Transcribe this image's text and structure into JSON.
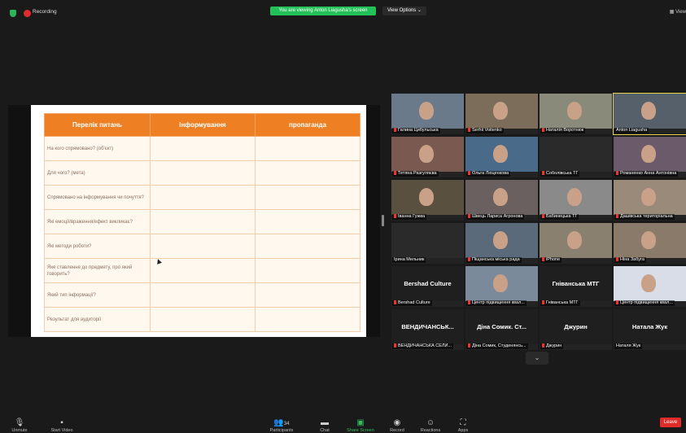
{
  "topbar": {
    "recording": "Recording",
    "viewing_banner": "You are viewing Anton Liagusha's screen",
    "view_options": "View Options ⌄",
    "view": "▦ View"
  },
  "slide": {
    "headers": [
      "Перелік питань",
      "Інформування",
      "пропаганда"
    ],
    "rows": [
      "На кого спрямовано? (об'єкт)",
      "Для чого? (мета)",
      "Спрямовано на інформування чи почуття?",
      "Які емоції/враження/ефект викликає?",
      "Які методи роботи?",
      "Яке ставлення до предмету, про який говорить?",
      "Який тип інформації?",
      "Результат для аудиторії"
    ]
  },
  "gallery": {
    "tiles": [
      {
        "name": "Галина Цибульська",
        "muted": true
      },
      {
        "name": "Serhii Voitenko",
        "muted": true
      },
      {
        "name": "Наталія Воротнюк",
        "muted": true
      },
      {
        "name": "Anton Liagusha",
        "muted": false
      },
      {
        "name": "Тетяна Разгуляєва",
        "muted": true
      },
      {
        "name": "Ольга Люценкова",
        "muted": true
      },
      {
        "name": "Соболівська ТГ",
        "muted": true
      },
      {
        "name": "Романенко Анна Антонівна",
        "muted": true
      },
      {
        "name": "Іванна Гужва",
        "muted": true
      },
      {
        "name": "Швець Лариса Агронова",
        "muted": true
      },
      {
        "name": "Бабинецька ТГ",
        "muted": true
      },
      {
        "name": "Дашівська територіальна",
        "muted": true
      },
      {
        "name": "Ірина Мельник",
        "muted": false
      },
      {
        "name": "Піщанська міська рада",
        "muted": true
      },
      {
        "name": "iPhone",
        "muted": true
      },
      {
        "name": "Ніна Забуга",
        "muted": true
      },
      {
        "name": "Bershad Culture",
        "muted": true,
        "label": "Bershad Culture"
      },
      {
        "name": "Центр підвищення квал...",
        "muted": true
      },
      {
        "name": "Гніванська МТГ",
        "muted": true,
        "label": "Гніванська МТГ"
      },
      {
        "name": "Центр підвищення квал...",
        "muted": true
      },
      {
        "name": "ВЕНДИЧАНСЬКА СЕЛИ...",
        "muted": true,
        "label": "ВЕНДИЧАНСЬК..."
      },
      {
        "name": "Діна Сомик, Студенянсь...",
        "muted": true,
        "label": "Діна Сомик. Ст..."
      },
      {
        "name": "Джурин",
        "muted": true,
        "label": "Джурин"
      },
      {
        "name": "Наталя Жук",
        "muted": false,
        "label": "Натала Жук"
      }
    ],
    "more": "⌄"
  },
  "toolbar": {
    "unmute": "Unmute",
    "start_video": "Start Video",
    "participants": "Participants",
    "participants_count": "34",
    "chat": "Chat",
    "share_screen": "Share Screen",
    "record": "Record",
    "reactions": "Reactions",
    "apps": "Apps",
    "leave": "Leave"
  }
}
